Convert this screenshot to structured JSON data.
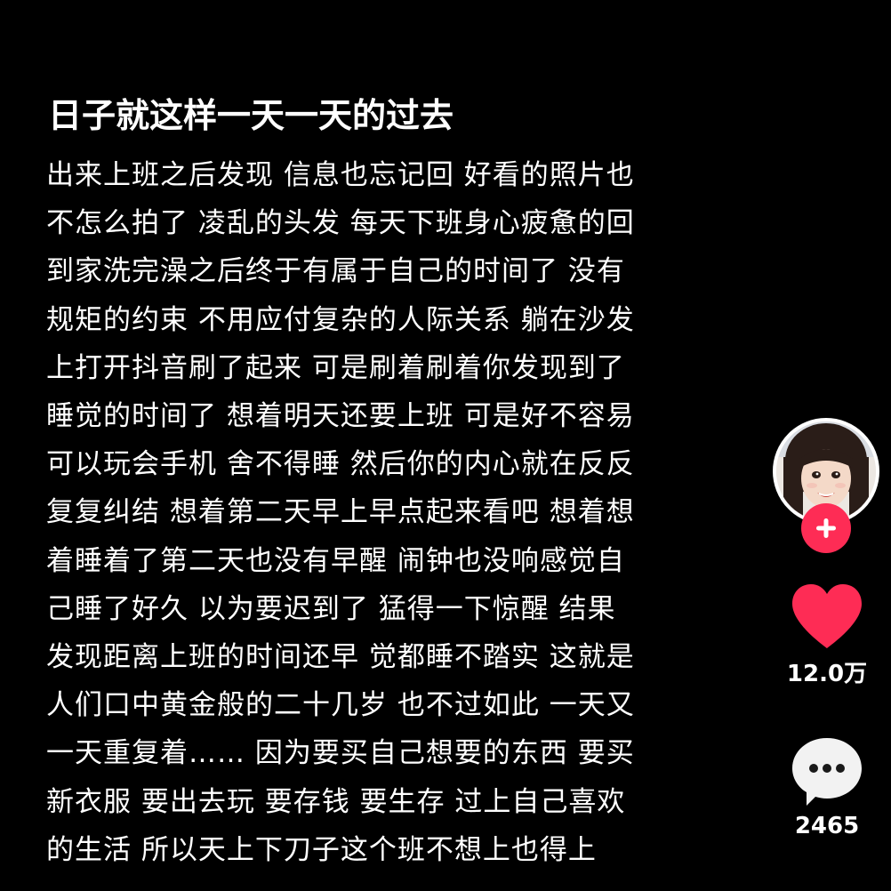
{
  "post": {
    "title": "日子就这样一天一天的过去",
    "lines": [
      "出来上班之后发现 信息也忘记回 好看的照片也",
      "不怎么拍了 凌乱的头发 每天下班身心疲惫的回",
      "到家洗完澡之后终于有属于自己的时间了 没有",
      "规矩的约束 不用应付复杂的人际关系 躺在沙发",
      "上打开抖音刷了起来 可是刷着刷着你发现到了",
      "睡觉的时间了 想着明天还要上班 可是好不容易",
      "可以玩会手机 舍不得睡 然后你的内心就在反反",
      "复复纠结 想着第二天早上早点起来看吧 想着想",
      "着睡着了第二天也没有早醒 闹钟也没响感觉自",
      "己睡了好久 以为要迟到了 猛得一下惊醒 结果",
      "发现距离上班的时间还早 觉都睡不踏实 这就是",
      "人们口中黄金般的二十几岁 也不过如此 一天又",
      "一天重复着…… 因为要买自己想要的东西 要买",
      "新衣服 要出去玩 要存钱 要生存 过上自己喜欢",
      "的生活 所以天上下刀子这个班不想上也得上"
    ]
  },
  "sidebar": {
    "avatar_icon": "user-avatar",
    "follow_icon": "plus-icon",
    "like": {
      "icon": "heart-icon",
      "count": "12.0万",
      "color": "#fe2c55"
    },
    "comment": {
      "icon": "comment-bubble-icon",
      "count": "2465"
    }
  }
}
